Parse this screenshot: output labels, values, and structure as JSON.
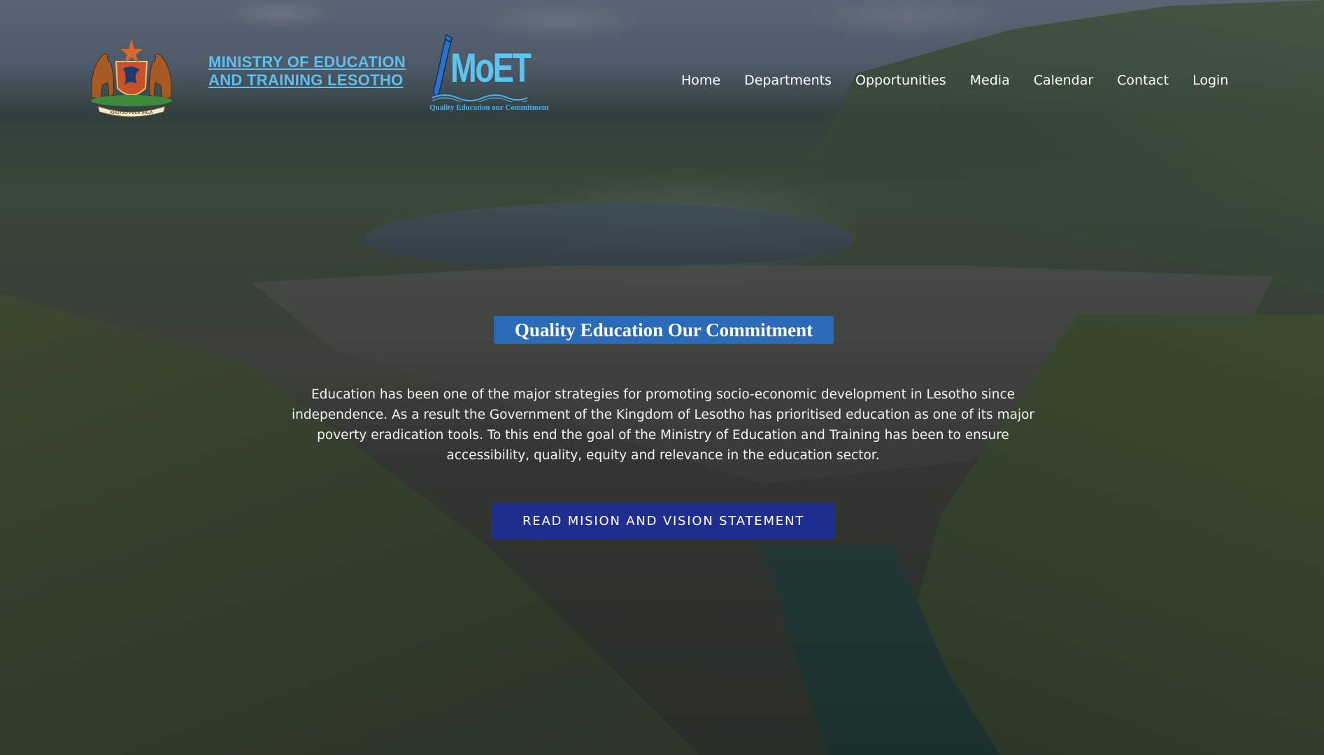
{
  "header": {
    "brand": {
      "title_line1": "MINISTRY OF EDUCATION",
      "title_line2": "AND TRAINING LESOTHO",
      "coat_of_arms_motto": "KHOTSO PULA NALA",
      "moet_logo_text": "MoET",
      "moet_tagline": "Quality Education our Commitment"
    },
    "nav": [
      {
        "label": "Home"
      },
      {
        "label": "Departments"
      },
      {
        "label": "Opportunities"
      },
      {
        "label": "Media"
      },
      {
        "label": "Calendar"
      },
      {
        "label": "Contact"
      },
      {
        "label": "Login"
      }
    ]
  },
  "hero": {
    "heading": "Quality Education Our Commitment",
    "paragraph": "Education has been one of the major strategies for promoting socio-economic development in Lesotho since independence. As a result the Government of the Kingdom of Lesotho has prioritised education as one of its major poverty eradication tools. To this end the goal of the Ministry of Education and Training has been to ensure accessibility, quality, equity and relevance in the education sector.",
    "cta_label": "READ MISION AND VISION STATEMENT",
    "background_image": "dam-landscape"
  },
  "colors": {
    "brand_blue": "#5fbfef",
    "heading_bg": "#2a6bb8",
    "cta_bg": "#1f2e8f"
  }
}
